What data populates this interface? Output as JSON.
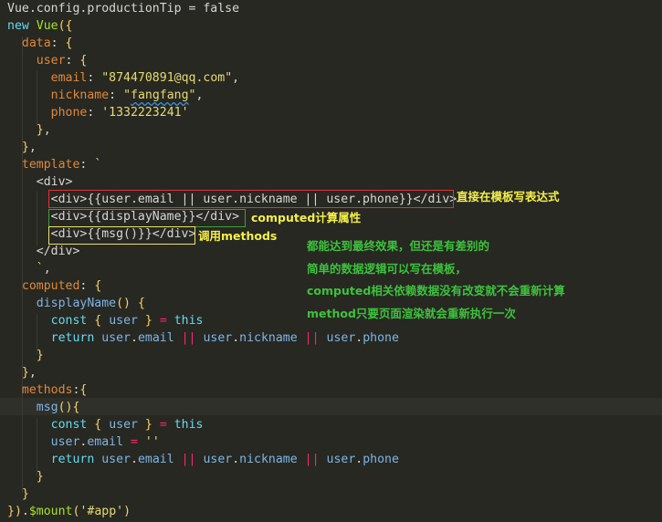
{
  "code_lines": [
    "Vue.config.productionTip = false",
    "new Vue({",
    "  data: {",
    "    user: {",
    "      email: \"874470891@qq.com\",",
    "      nickname: \"fangfang\",",
    "      phone: '1332223241'",
    "    },",
    "  },",
    "  template: `",
    "    <div>",
    "      <div>{{user.email || user.nickname || user.phone}}</div>",
    "      <div>{{displayName}}</div>",
    "      <div>{{msg()}}</div>",
    "    </div>",
    "    `,",
    "  computed: {",
    "    displayName() {",
    "      const { user } = this",
    "      return user.email || user.nickname || user.phone",
    "    }",
    "  },",
    "  methods:{",
    "    msg(){",
    "      const { user } = this",
    "      user.email = ''",
    "      return user.email || user.nickname || user.phone",
    "    }",
    "  }",
    "}).$mount('#app')"
  ],
  "annotations": {
    "template_expression": "直接在模板写表达式",
    "computed_property": "computed计算属性",
    "call_method": "调用methods",
    "notes": [
      "都能达到最终效果，但还是有差别的",
      "简单的数据逻辑可以写在模板，",
      "computed相关依赖数据没有改变就不会重新计算",
      "method只要页面渲染就会重新执行一次"
    ]
  },
  "colors": {
    "background": "#272822",
    "red_box": "#e0303a",
    "green_box": "#3ca03c",
    "yellow_box": "#e8e070",
    "annotation_yellow": "#f5ef4a",
    "annotation_green": "#3dc23d"
  }
}
